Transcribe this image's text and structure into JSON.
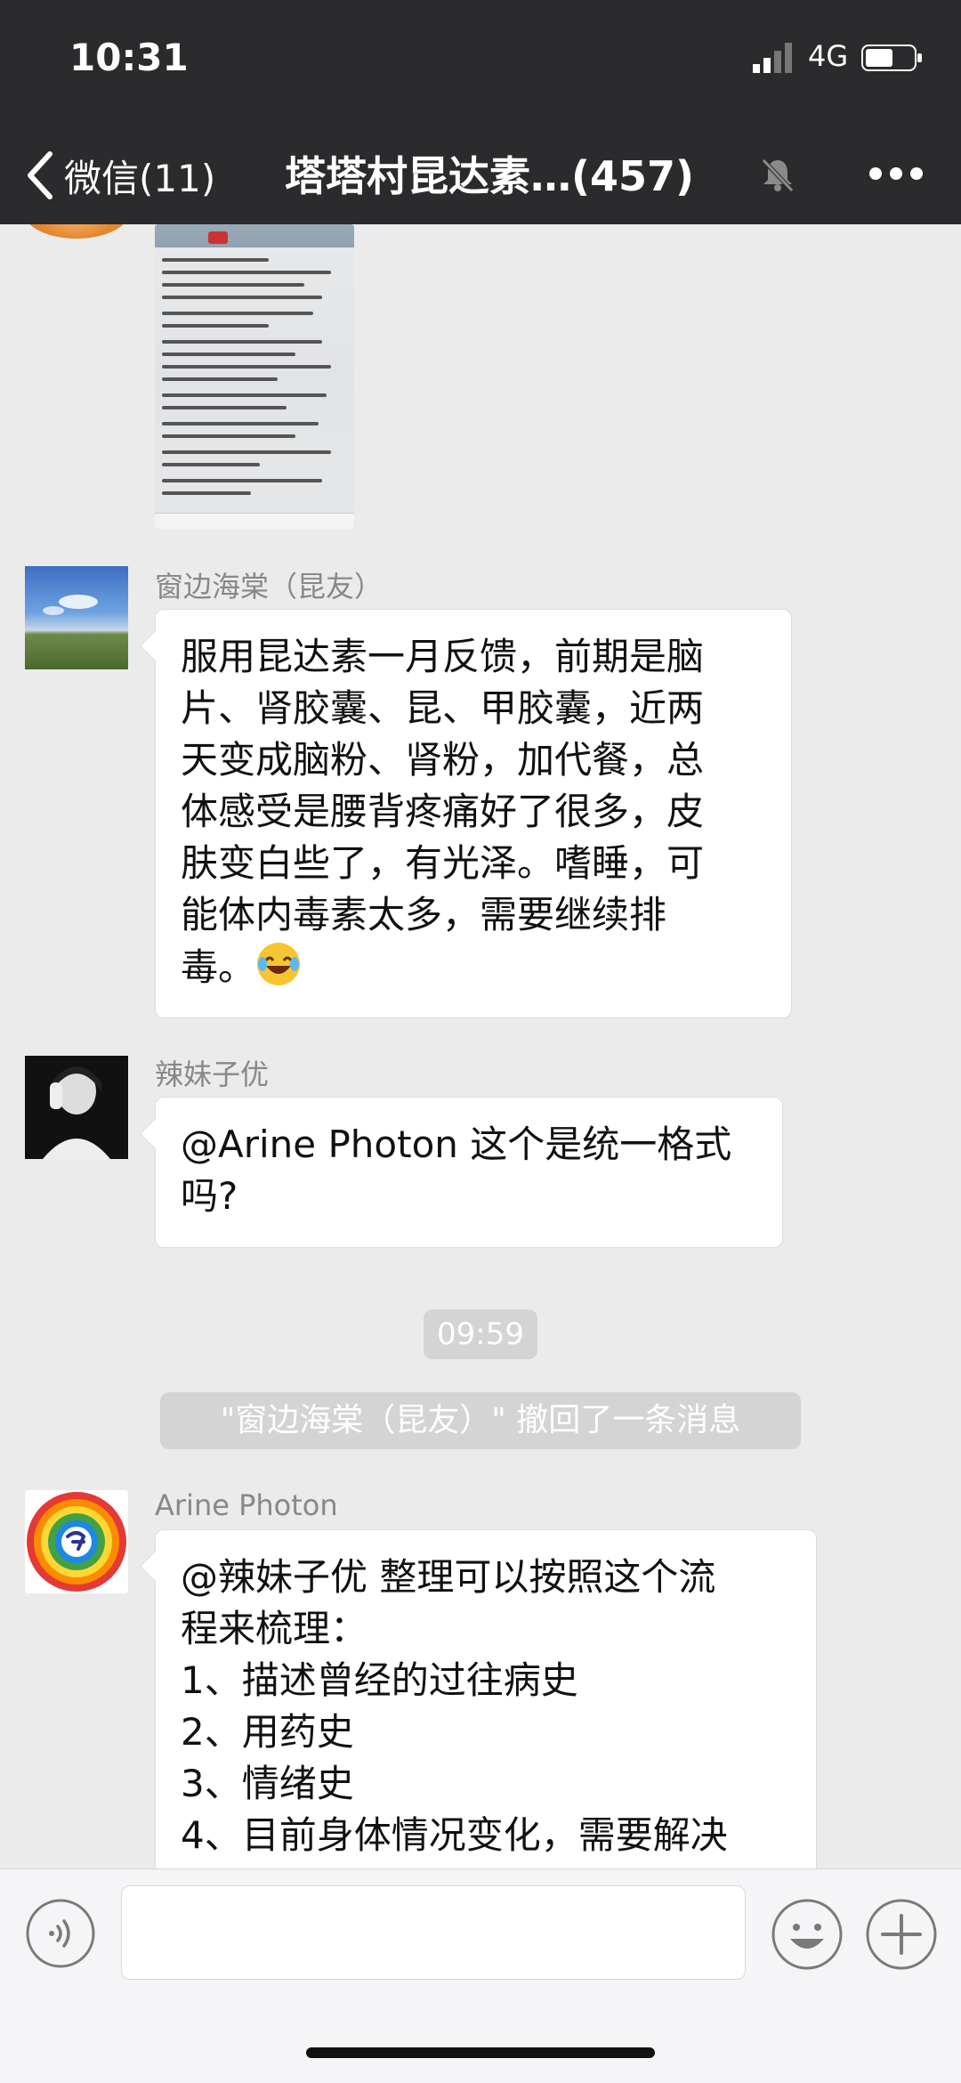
{
  "status_bar": {
    "time": "10:31",
    "network": "4G"
  },
  "nav": {
    "back_label": "微信(11)",
    "title": "塔塔村昆达素…(457)",
    "icons": {
      "back": "chevron-left-icon",
      "mute": "mute-bell-icon",
      "more": "more-dots-icon"
    }
  },
  "messages": [
    {
      "sender": "窗边海棠（昆友）",
      "lines": [
        "服用昆达素一月反馈，前期是脑",
        "片、肾胶囊、昆、甲胶囊，近两",
        "天变成脑粉、肾粉，加代餐，总",
        "体感受是腰背疼痛好了很多，皮",
        "肤变白些了，有光泽。嗜睡，可",
        "能体内毒素太多，需要继续排",
        "毒。"
      ],
      "emoji": "laughing-tears-emoji"
    },
    {
      "sender": "辣妹子优",
      "lines": [
        "@Arine Photon 这个是统一格式",
        "吗?"
      ]
    },
    {
      "sender": "Arine Photon",
      "lines": [
        "@辣妹子优 整理可以按照这个流",
        "程来梳理：",
        "1、描述曾经的过往病史",
        "2、用药史",
        "3、情绪史",
        "4、目前身体情况变化，需要解决"
      ]
    }
  ],
  "system": {
    "timestamp": "09:59",
    "recall_notice": "\"窗边海棠（昆友）\" 撤回了一条消息"
  },
  "input_bar": {
    "icons": {
      "voice": "voice-icon",
      "emoji": "emoji-icon",
      "plus": "plus-icon"
    }
  }
}
